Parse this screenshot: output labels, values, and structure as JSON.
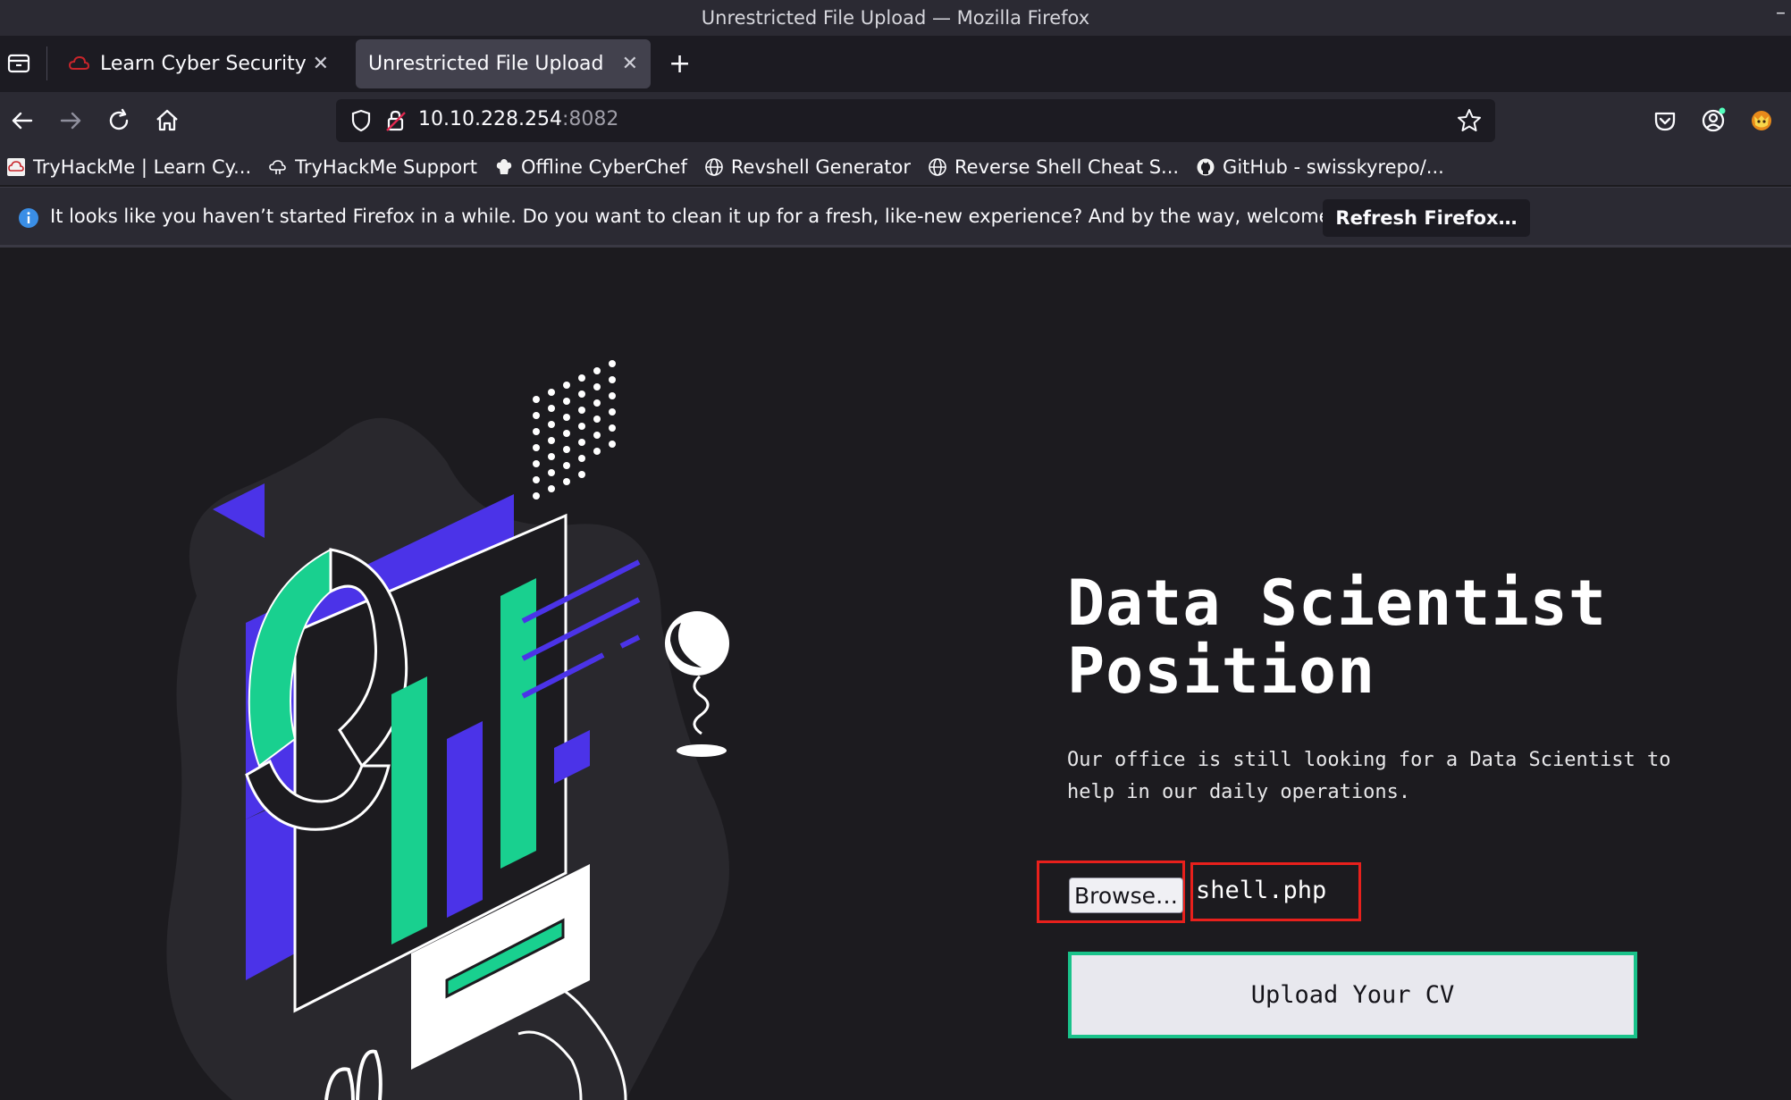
{
  "window": {
    "title": "Unrestricted File Upload — Mozilla Firefox"
  },
  "tabs": [
    {
      "label": "Learn Cyber Security | Try",
      "active": false,
      "favicon": "tryhackme-cloud-icon"
    },
    {
      "label": "Unrestricted File Upload",
      "active": true
    }
  ],
  "toolbar": {
    "url_host": "10.10.228.254",
    "url_port": ":8082"
  },
  "bookmarks": [
    {
      "label": "TryHackMe | Learn Cy...",
      "icon": "tryhackme-icon"
    },
    {
      "label": "TryHackMe Support",
      "icon": "support-cloud-icon"
    },
    {
      "label": "Offline CyberChef",
      "icon": "chef-hat-icon"
    },
    {
      "label": "Revshell Generator",
      "icon": "globe-icon"
    },
    {
      "label": "Reverse Shell Cheat S...",
      "icon": "globe-icon"
    },
    {
      "label": "GitHub - swisskyrepo/...",
      "icon": "github-icon"
    }
  ],
  "notification": {
    "message": "It looks like you haven’t started Firefox in a while. Do you want to clean it up for a fresh, like-new experience? And by the way, welcome back!",
    "button_label": "Refresh Firefox…"
  },
  "page": {
    "heading_line1": "Data Scientist",
    "heading_line2": "Position",
    "description_line1": "Our office is still looking for a Data Scientist to",
    "description_line2": "help in our daily operations.",
    "browse_label": "Browse…",
    "selected_file": "shell.php",
    "upload_label": "Upload Your CV"
  },
  "colors": {
    "accent_purple": "#4b33e8",
    "accent_green": "#19d08f",
    "highlight_red": "#e8201c",
    "background": "#1c1b1f"
  }
}
